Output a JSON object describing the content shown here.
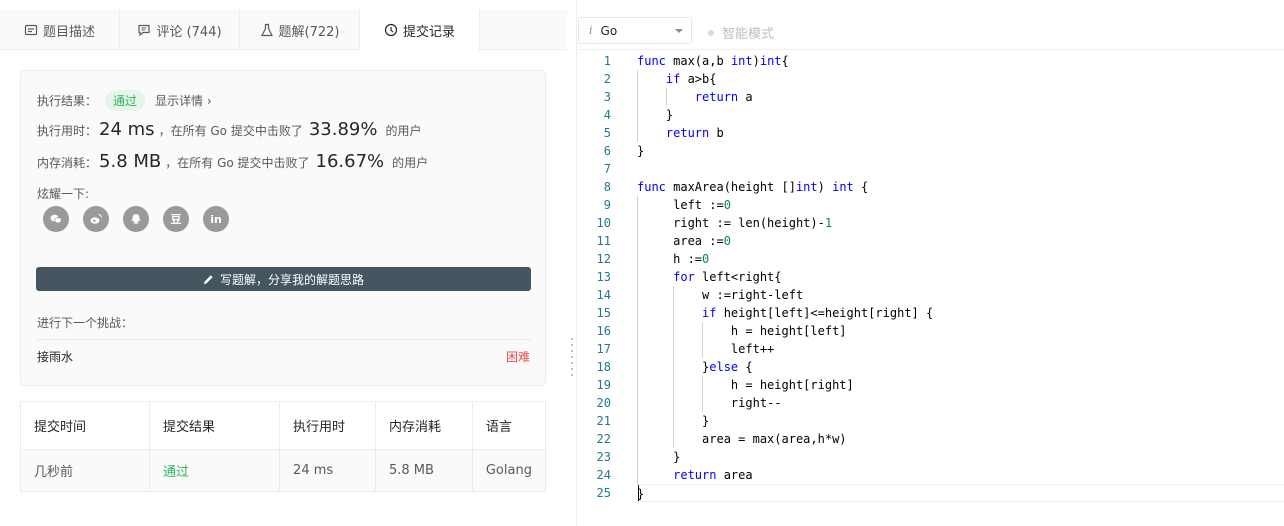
{
  "tabs": [
    {
      "label": "题目描述",
      "icon": "description-icon"
    },
    {
      "label": "评论 (744)",
      "icon": "comment-icon"
    },
    {
      "label": "题解(722)",
      "icon": "flask-icon"
    },
    {
      "label": "提交记录",
      "icon": "clock-icon",
      "active": true
    }
  ],
  "result": {
    "status_label": "执行结果：",
    "status_value": "通过",
    "detail_link": "显示详情 ›",
    "runtime_label": "执行用时：",
    "runtime_value": "24 ms",
    "runtime_mid": "，在所有 Go 提交中击败了",
    "runtime_percent": "33.89%",
    "runtime_suffix": "的用户",
    "memory_label": "内存消耗：",
    "memory_value": "5.8 MB",
    "memory_mid": "，在所有 Go 提交中击败了",
    "memory_percent": "16.67%",
    "memory_suffix": "的用户",
    "share_label": "炫耀一下:",
    "socials": [
      "wechat-icon",
      "weibo-icon",
      "qq-icon",
      "douban-icon",
      "linkedin-icon"
    ],
    "douban_text": "豆",
    "linkedin_text": "in",
    "write_button": "写题解，分享我的解题思路",
    "next_label": "进行下一个挑战：",
    "next_problem": "接雨水",
    "next_difficulty": "困难"
  },
  "submissions": {
    "headers": [
      "提交时间",
      "提交结果",
      "执行用时",
      "内存消耗",
      "语言"
    ],
    "rows": [
      [
        "几秒前",
        "通过",
        "24 ms",
        "5.8 MB",
        "Golang"
      ]
    ]
  },
  "editor": {
    "language": "Go",
    "language_icon_text": "i",
    "smart_mode": "智能模式",
    "lines": [
      "func max(a,b int)int{",
      "    if a>b{",
      "        return a",
      "    }",
      "    return b",
      "}",
      "",
      "func maxArea(height []int) int {",
      "     left :=0",
      "     right := len(height)-1",
      "     area :=0",
      "     h :=0",
      "     for left<right{",
      "         w :=right-left",
      "         if height[left]<=height[right] {",
      "             h = height[left]",
      "             left++",
      "         }else {",
      "             h = height[right]",
      "             right--",
      "         }",
      "         area = max(area,h*w)",
      "     }",
      "     return area",
      "}"
    ]
  },
  "colors": {
    "accent_green": "#2db55d",
    "hard_red": "#ec4c47",
    "button_dark": "#465660",
    "keyword_blue": "#0000ff",
    "number_green": "#098658",
    "line_number": "#237893"
  }
}
